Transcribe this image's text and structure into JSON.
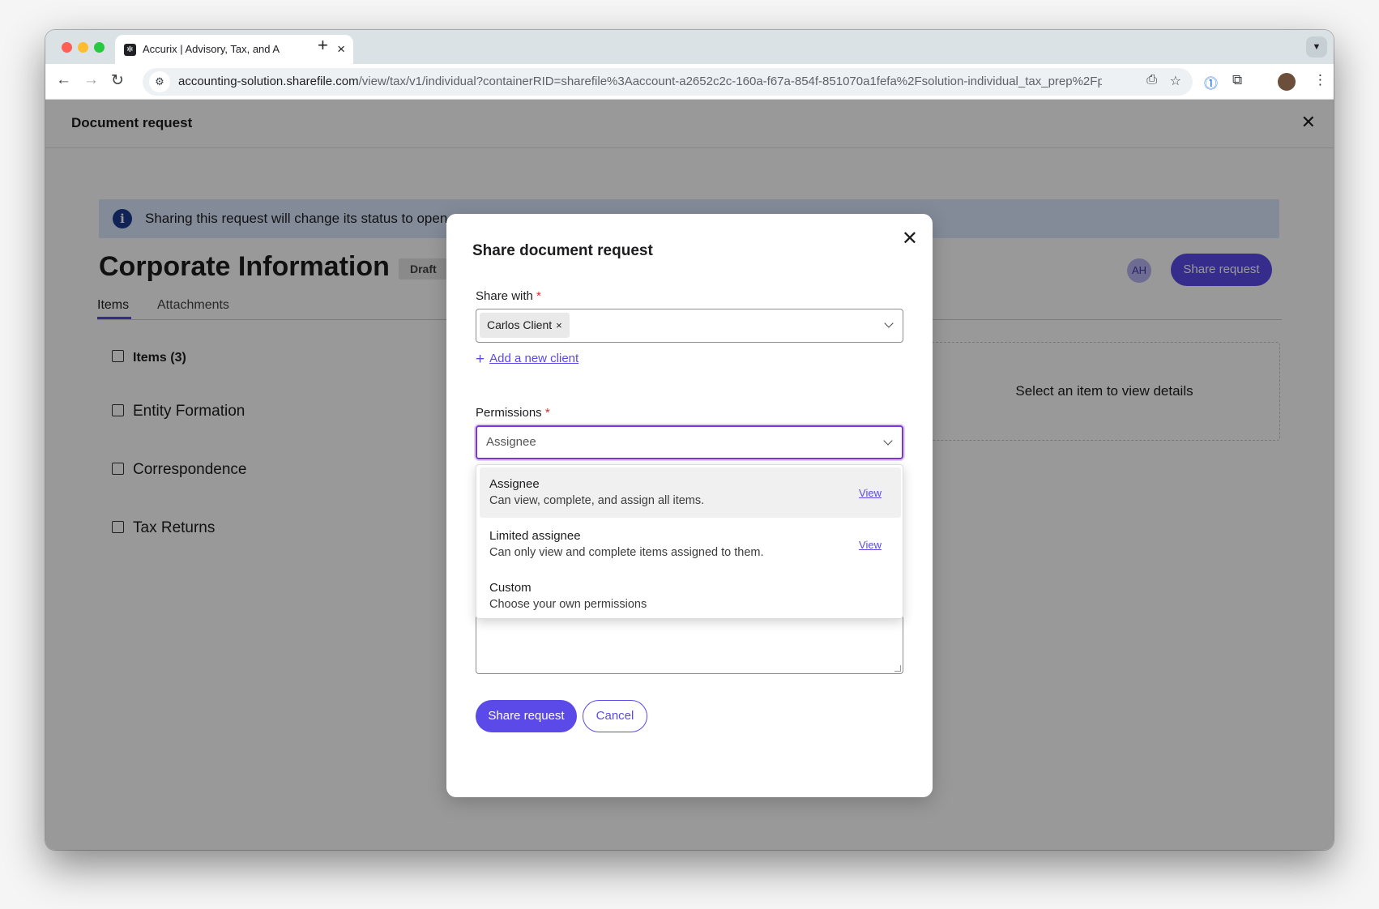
{
  "browser": {
    "tab_title": "Accurix | Advisory, Tax, and A",
    "new_tab": "+",
    "url_host": "accounting-solution.sharefile.com",
    "url_path": "/view/tax/v1/individual?containerRID=sharefile%3Aaccount-a2652c2c-160a-f67a-854f-851070a1fefa%2Fsolution-individual_tax_prep%2Fproj..."
  },
  "app": {
    "header_title": "Document request",
    "banner_text": "Sharing this request will change its status to open",
    "doc_title": "Corporate Information",
    "status_badge": "Draft",
    "avatar_initials": "AH",
    "share_button": "Share request",
    "tabs": [
      {
        "label": "Items"
      },
      {
        "label": "Attachments"
      }
    ],
    "items_header": "Items (3)",
    "items": [
      {
        "label": "Entity Formation"
      },
      {
        "label": "Correspondence"
      },
      {
        "label": "Tax Returns"
      }
    ],
    "details_placeholder": "Select an item to view details"
  },
  "modal": {
    "title": "Share document request",
    "share_with_label": "Share with",
    "required_mark": "*",
    "selected_client": "Carlos Client",
    "chip_remove": "×",
    "add_client_plus": "+",
    "add_client_link": "Add a new client",
    "permissions_label": "Permissions",
    "permissions_value": "Assignee",
    "options": [
      {
        "label": "Assignee",
        "description": "Can view, complete, and assign all items.",
        "link": "View"
      },
      {
        "label": "Limited assignee",
        "description": "Can only view and complete items assigned to them.",
        "link": "View"
      },
      {
        "label": "Custom",
        "description": "Choose your own permissions"
      }
    ],
    "share_button": "Share request",
    "cancel_button": "Cancel"
  },
  "colors": {
    "primary": "#5b4ae8",
    "focus_ring": "#7b35d8",
    "banner_bg": "#dbe8ff",
    "required": "#d12e2e"
  }
}
